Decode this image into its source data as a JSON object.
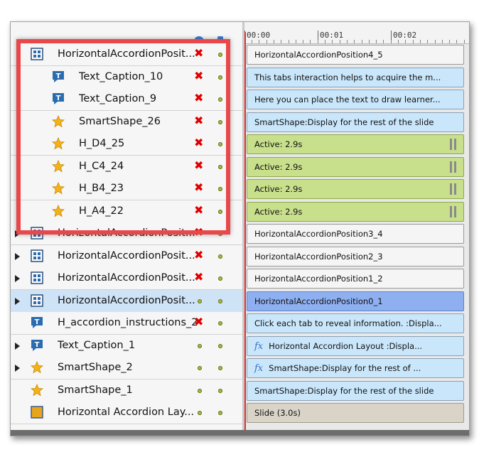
{
  "ruler": {
    "ticks": [
      "00:00",
      "00:01",
      "00:02"
    ]
  },
  "rows": [
    {
      "name": "HorizontalAccordionPosit...",
      "icon": "group-icon",
      "indent": 0,
      "expander": false,
      "vis": "hidden",
      "bar": "HorizontalAccordionPosition4_5",
      "barType": "group",
      "fx": false
    },
    {
      "name": "Text_Caption_10",
      "icon": "text-caption-icon",
      "indent": 1,
      "expander": false,
      "vis": "hidden",
      "bar": "This tabs interaction helps to acquire the m...",
      "barType": "text",
      "fx": false
    },
    {
      "name": "Text_Caption_9",
      "icon": "text-caption-icon",
      "indent": 1,
      "expander": false,
      "vis": "hidden",
      "bar": "Here you can place the text to draw learner...",
      "barType": "text",
      "fx": false
    },
    {
      "name": "SmartShape_26",
      "icon": "smartshape-star-icon",
      "indent": 1,
      "expander": false,
      "vis": "hidden",
      "bar": "SmartShape:Display for the rest of the slide",
      "barType": "text",
      "fx": false
    },
    {
      "name": "H_D4_25",
      "icon": "smartshape-star-icon",
      "indent": 1,
      "expander": false,
      "vis": "hidden",
      "bar": "Active: 2.9s",
      "barType": "active",
      "fx": false
    },
    {
      "name": "H_C4_24",
      "icon": "smartshape-star-icon",
      "indent": 1,
      "expander": false,
      "vis": "hidden",
      "bar": "Active: 2.9s",
      "barType": "active",
      "fx": false
    },
    {
      "name": "H_B4_23",
      "icon": "smartshape-star-icon",
      "indent": 1,
      "expander": false,
      "vis": "hidden",
      "bar": "Active: 2.9s",
      "barType": "active",
      "fx": false
    },
    {
      "name": "H_A4_22",
      "icon": "smartshape-star-icon",
      "indent": 1,
      "expander": false,
      "vis": "hidden",
      "bar": "Active: 2.9s",
      "barType": "active",
      "fx": false
    },
    {
      "name": "HorizontalAccordionPosit...",
      "icon": "group-icon",
      "indent": 0,
      "expander": true,
      "vis": "hidden",
      "bar": "HorizontalAccordionPosition3_4",
      "barType": "group",
      "fx": false
    },
    {
      "name": "HorizontalAccordionPosit...",
      "icon": "group-icon",
      "indent": 0,
      "expander": true,
      "vis": "hidden",
      "bar": "HorizontalAccordionPosition2_3",
      "barType": "group",
      "fx": false
    },
    {
      "name": "HorizontalAccordionPosit...",
      "icon": "group-icon",
      "indent": 0,
      "expander": true,
      "vis": "hidden",
      "bar": "HorizontalAccordionPosition1_2",
      "barType": "group",
      "fx": false
    },
    {
      "name": "HorizontalAccordionPosit...",
      "icon": "group-icon",
      "indent": 0,
      "expander": true,
      "vis": "visible",
      "bar": "HorizontalAccordionPosition0_1",
      "barType": "selbar",
      "fx": false,
      "selected": true
    },
    {
      "name": "H_accordion_instructions_2",
      "icon": "text-caption-icon",
      "indent": 0,
      "expander": false,
      "vis": "hidden",
      "bar": "Click each tab to reveal information. :Displa...",
      "barType": "text",
      "fx": false
    },
    {
      "name": "Text_Caption_1",
      "icon": "text-caption-icon",
      "indent": 0,
      "expander": true,
      "vis": "visible",
      "bar": "Horizontal Accordion Layout :Displa...",
      "barType": "text",
      "fx": true
    },
    {
      "name": "SmartShape_2",
      "icon": "smartshape-star-icon",
      "indent": 0,
      "expander": true,
      "vis": "visible",
      "bar": "SmartShape:Display for the rest of ...",
      "barType": "text",
      "fx": true
    },
    {
      "name": "SmartShape_1",
      "icon": "smartshape-star-icon",
      "indent": 0,
      "expander": false,
      "vis": "visible",
      "bar": "SmartShape:Display for the rest of the slide",
      "barType": "text",
      "fx": false
    },
    {
      "name": "Horizontal Accordion Lay...",
      "icon": "slide-icon",
      "indent": 0,
      "expander": false,
      "vis": "visible",
      "bar": "Slide (3.0s)",
      "barType": "slide",
      "fx": false
    }
  ],
  "colors": {
    "hidden": "#e00000",
    "dot": "#a8b642",
    "highlight": "#e9484a",
    "active": "#c8df8c",
    "text": "#c9e6fb",
    "selected": "#8fb0f0"
  }
}
